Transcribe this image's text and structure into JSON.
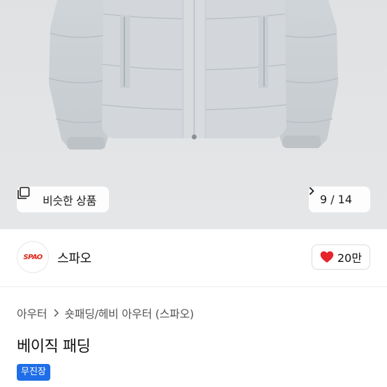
{
  "image": {
    "similar_button_label": "비슷한 상품",
    "counter_text": "9 / 14"
  },
  "brand": {
    "logo_text": "SPAO",
    "name": "스파오",
    "like_count": "20만"
  },
  "breadcrumb": {
    "category": "아우터",
    "subcategory": "숏패딩/헤비 아우터 (스파오)"
  },
  "product": {
    "title": "베이직 패딩",
    "badge": "무진장"
  },
  "colors": {
    "accent": "#1f6ee8",
    "heart": "#e5252a",
    "brand_red": "#e1251b"
  },
  "icons": {
    "similar": "gallery-stack-icon",
    "counter": "chevron-right-icon",
    "breadcrumb_separator": "chevron-right-icon",
    "like": "heart-icon"
  }
}
